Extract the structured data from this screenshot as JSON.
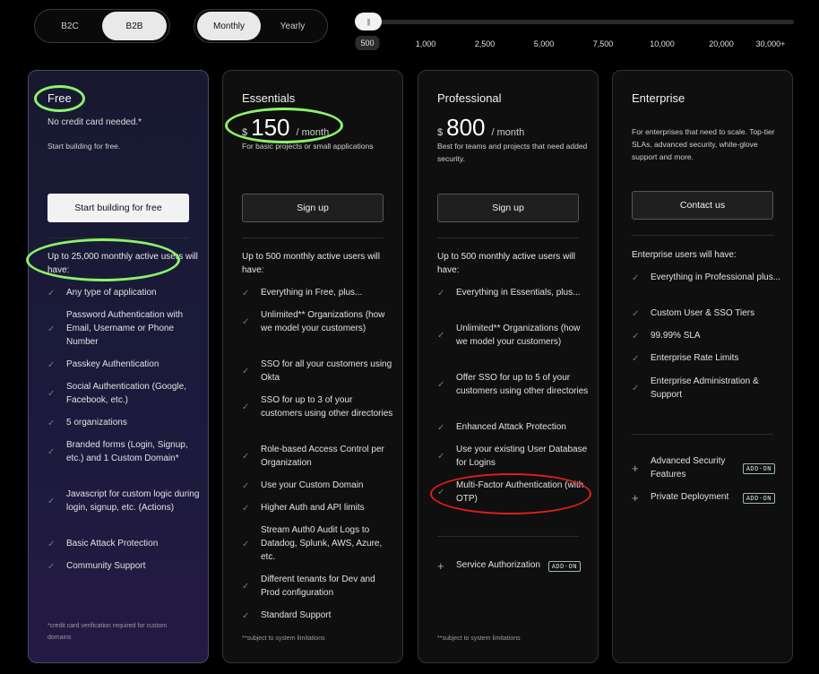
{
  "audience_toggle": {
    "options": [
      "B2C",
      "B2B"
    ],
    "selected": "B2B"
  },
  "billing_toggle": {
    "options": [
      "Monthly",
      "Yearly"
    ],
    "selected": "Monthly"
  },
  "users_slider": {
    "labels": [
      "500",
      "1,000",
      "2,500",
      "5,000",
      "7,500",
      "10,000",
      "20,000",
      "30,000+"
    ],
    "selected": "500",
    "thumb_glyph": "|||"
  },
  "plans": {
    "free": {
      "name": "Free",
      "subtitle": "No credit card needed.*",
      "description": "Start building for free.",
      "cta": "Start building for free",
      "intro": "Up to 25,000 monthly active users will have:",
      "features": [
        "Any type of application",
        "Password Authentication with Email, Username or Phone Number",
        "Passkey Authentication",
        "Social Authentication (Google, Facebook, etc.)",
        "5 organizations",
        "Branded forms (Login, Signup, etc.) and 1 Custom Domain*",
        "Javascript for custom logic during login, signup, etc. (Actions)",
        "Basic Attack Protection",
        "Community Support"
      ],
      "footnote": "*credit card verification required for custom domains"
    },
    "essentials": {
      "name": "Essentials",
      "currency": "$",
      "price": "150",
      "period": "/ month",
      "description": "For basic projects or small applications",
      "cta": "Sign up",
      "intro": "Up to 500 monthly active users will have:",
      "features": [
        "Everything in Free, plus...",
        "Unlimited** Organizations (how we model your customers)",
        "SSO for all your customers using Okta",
        "SSO for up to 3 of your customers using other directories",
        "Role-based Access Control per Organization",
        "Use your Custom Domain",
        "Higher Auth and API limits",
        "Stream Auth0 Audit Logs to Datadog, Splunk, AWS, Azure, etc.",
        "Different tenants for Dev and Prod configuration",
        "Standard Support"
      ],
      "footnote": "**subject to system limitations"
    },
    "professional": {
      "name": "Professional",
      "currency": "$",
      "price": "800",
      "period": "/ month",
      "description": "Best for teams and projects that need added security.",
      "cta": "Sign up",
      "intro": "Up to 500 monthly active users will have:",
      "features": [
        "Everything in Essentials, plus...",
        "Unlimited** Organizations (how we model your customers)",
        "Offer SSO for up to 5 of your customers using other directories",
        "Enhanced Attack Protection",
        "Use your existing User Database for Logins",
        "Multi-Factor Authentication (with OTP)"
      ],
      "addons": [
        {
          "label": "Service Authorization",
          "badge": "ADD-ON"
        }
      ],
      "footnote": "**subject to system limitations"
    },
    "enterprise": {
      "name": "Enterprise",
      "description": "For enterprises that need to scale. Top-tier SLAs, advanced security, white-glove support and more.",
      "cta": "Contact us",
      "intro": "Enterprise users will have:",
      "features": [
        "Everything in Professional plus...",
        "Custom User & SSO Tiers",
        "99.99% SLA",
        "Enterprise Rate Limits",
        "Enterprise Administration & Support"
      ],
      "addons": [
        {
          "label": "Advanced Security Features",
          "badge": "ADD-ON"
        },
        {
          "label": "Private Deployment",
          "badge": "ADD-ON"
        }
      ]
    }
  },
  "check_glyph": "✓",
  "plus_glyph": "+",
  "colors": {
    "annotation_green": "#8df26a",
    "annotation_red": "#e21d1d",
    "free_card_gradient_end": "#241a44"
  }
}
